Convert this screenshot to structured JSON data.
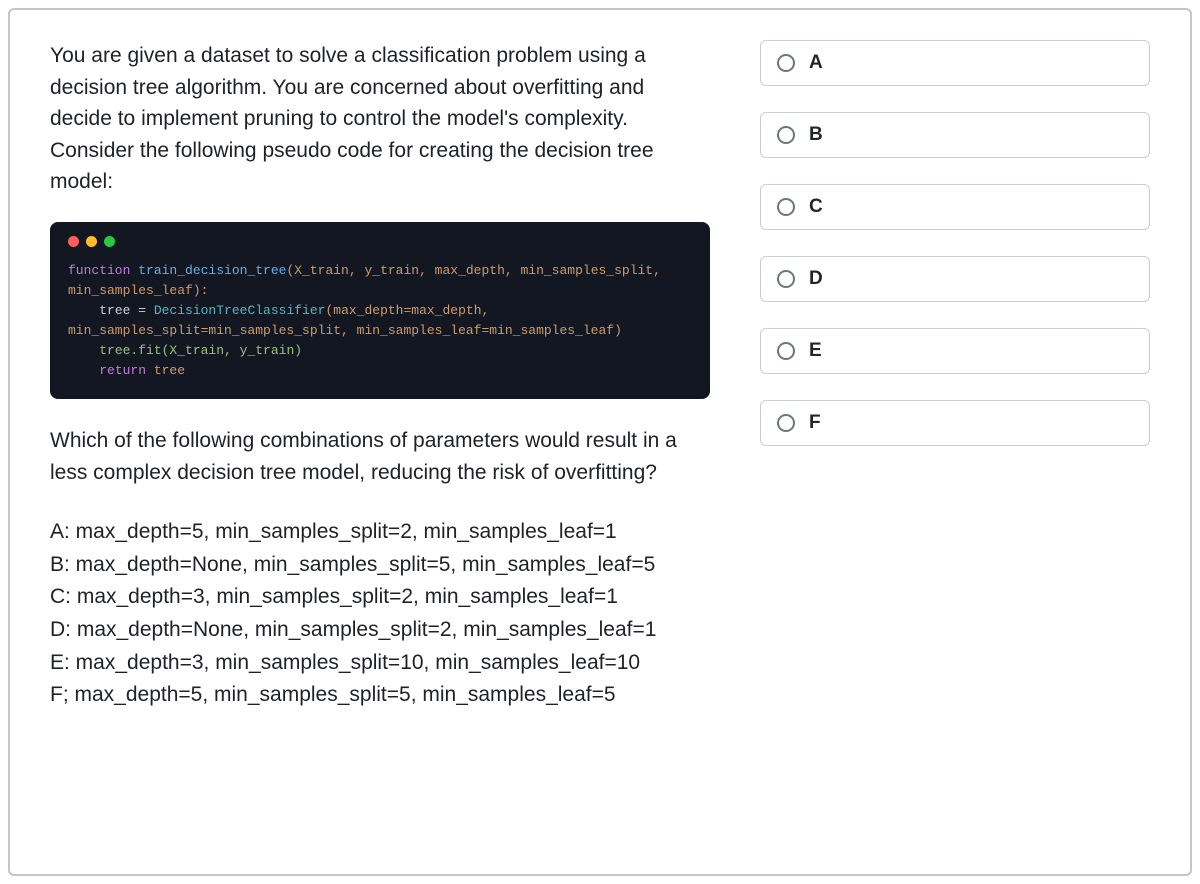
{
  "question": {
    "intro": "You are given a dataset to solve a classification problem using a decision tree algorithm. You are concerned about overfitting and decide to implement pruning to control the model's complexity. Consider the following pseudo code for creating the decision tree model:",
    "follow": "Which of the following combinations of parameters would result in a less complex decision tree model, reducing the risk of overfitting?",
    "options_text": {
      "A": "A: max_depth=5, min_samples_split=2, min_samples_leaf=1",
      "B": "B: max_depth=None, min_samples_split=5, min_samples_leaf=5",
      "C": "C: max_depth=3, min_samples_split=2, min_samples_leaf=1",
      "D": "D: max_depth=None, min_samples_split=2, min_samples_leaf=1",
      "E": "E: max_depth=3, min_samples_split=10, min_samples_leaf=10",
      "F": "F; max_depth=5, min_samples_split=5, min_samples_leaf=5"
    }
  },
  "code": {
    "l1_kw": "function",
    "l1_fn": " train_decision_tree",
    "l1_rest": "(X_train, y_train, max_depth, min_samples_split, min_samples_leaf):",
    "l2_pre": "    tree = ",
    "l2_cls": "DecisionTreeClassifier",
    "l2_rest": "(max_depth=max_depth, min_samples_split=min_samples_split, min_samples_leaf=min_samples_leaf)",
    "l3": "    tree.fit(X_train, y_train)",
    "l4_kw": "    return",
    "l4_rest": " tree"
  },
  "answers": [
    {
      "label": "A"
    },
    {
      "label": "B"
    },
    {
      "label": "C"
    },
    {
      "label": "D"
    },
    {
      "label": "E"
    },
    {
      "label": "F"
    }
  ]
}
